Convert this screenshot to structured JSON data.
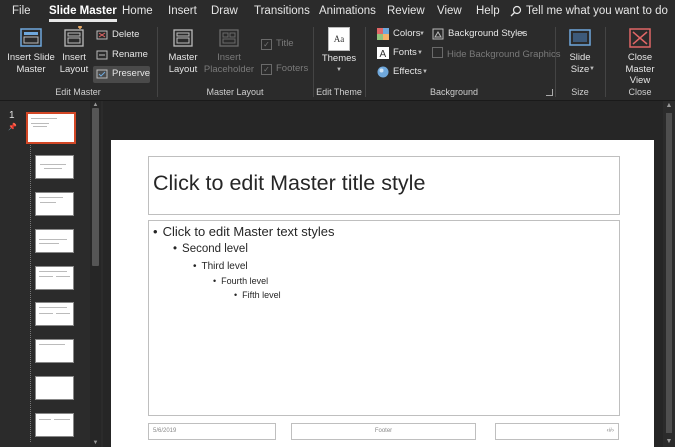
{
  "menu": {
    "tabs": [
      {
        "label": "File"
      },
      {
        "label": "Slide Master"
      },
      {
        "label": "Home"
      },
      {
        "label": "Insert"
      },
      {
        "label": "Draw"
      },
      {
        "label": "Transitions"
      },
      {
        "label": "Animations"
      },
      {
        "label": "Review"
      },
      {
        "label": "View"
      },
      {
        "label": "Help"
      }
    ],
    "tell_me": "Tell me what you want to do"
  },
  "ribbon": {
    "edit_master": {
      "label": "Edit Master",
      "insert_slide_master": "Insert Slide Master",
      "insert_layout": "Insert Layout",
      "delete": "Delete",
      "rename": "Rename",
      "preserve": "Preserve"
    },
    "master_layout": {
      "label": "Master Layout",
      "master_layout_btn": "Master Layout",
      "insert_placeholder": "Insert Placeholder",
      "title_chk": "Title",
      "footers_chk": "Footers"
    },
    "edit_theme": {
      "label": "Edit Theme",
      "themes": "Themes"
    },
    "background": {
      "label": "Background",
      "colors": "Colors",
      "fonts": "Fonts",
      "effects": "Effects",
      "background_styles": "Background Styles",
      "hide_bg": "Hide Background Graphics"
    },
    "size": {
      "label": "Size",
      "slide_size": "Slide Size"
    },
    "close": {
      "label": "Close",
      "close_master_view": "Close Master View"
    }
  },
  "thumbnails": {
    "slide_number": "1"
  },
  "slide": {
    "title": "Click to edit Master title style",
    "levels": [
      "Click to edit Master text styles",
      "Second level",
      "Third level",
      "Fourth level",
      "Fifth level"
    ],
    "footer_date": "5/6/2019",
    "footer_text": "Footer",
    "footer_num": "‹#›"
  },
  "colors": {
    "accent_selected": "#d24726",
    "ribbon_bg": "#2b2b2b",
    "canvas_bg": "#262626"
  }
}
